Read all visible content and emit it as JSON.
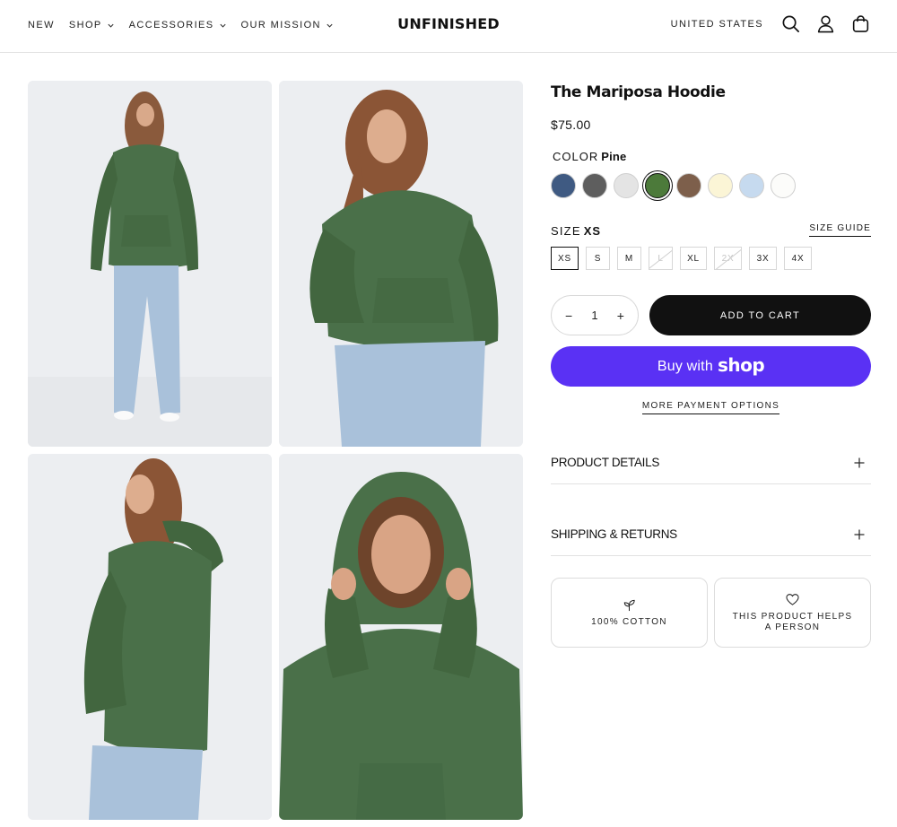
{
  "header": {
    "nav": [
      {
        "label": "NEW",
        "has_dropdown": false
      },
      {
        "label": "SHOP",
        "has_dropdown": true
      },
      {
        "label": "ACCESSORIES",
        "has_dropdown": true
      },
      {
        "label": "OUR MISSION",
        "has_dropdown": true
      }
    ],
    "logo": "UNFINISHED",
    "country": "UNITED STATES",
    "icons": [
      "search-icon",
      "account-icon",
      "cart-bag-icon"
    ]
  },
  "gallery": {
    "hoodie_color": "#4a7049",
    "jeans_color": "#a9c1da",
    "photos": [
      "front-full-length",
      "front-three-quarter",
      "back-side",
      "hood-up-closeup"
    ]
  },
  "product": {
    "title": "The Mariposa Hoodie",
    "price": "$75.00",
    "color_label": "COLOR",
    "color_selected": "Pine",
    "swatches": [
      {
        "name": "Navy",
        "hex": "#3f5a82",
        "selected": false
      },
      {
        "name": "Charcoal",
        "hex": "#5e5e5e",
        "selected": false
      },
      {
        "name": "Heather",
        "hex": "#e4e4e4",
        "selected": false
      },
      {
        "name": "Pine",
        "hex": "#4c7a3a",
        "selected": true
      },
      {
        "name": "Mocha",
        "hex": "#7d5f4b",
        "selected": false
      },
      {
        "name": "Cream",
        "hex": "#fbf5d6",
        "selected": false
      },
      {
        "name": "Sky",
        "hex": "#c6daef",
        "selected": false
      },
      {
        "name": "White",
        "hex": "#fcfcfa",
        "selected": false
      }
    ],
    "size_label": "SIZE",
    "size_selected": "XS",
    "size_guide": "SIZE GUIDE",
    "sizes": [
      {
        "label": "XS",
        "available": true,
        "selected": true
      },
      {
        "label": "S",
        "available": true,
        "selected": false
      },
      {
        "label": "M",
        "available": true,
        "selected": false
      },
      {
        "label": "L",
        "available": false,
        "selected": false
      },
      {
        "label": "XL",
        "available": true,
        "selected": false
      },
      {
        "label": "2X",
        "available": false,
        "selected": false
      },
      {
        "label": "3X",
        "available": true,
        "selected": false
      },
      {
        "label": "4X",
        "available": true,
        "selected": false
      }
    ],
    "quantity": "1",
    "qty_minus": "−",
    "qty_plus": "+",
    "add_to_cart": "ADD TO CART",
    "buy_with": "Buy with",
    "shop_brand": "shop",
    "more_payment": "MORE PAYMENT OPTIONS",
    "accordions": [
      {
        "label": "PRODUCT DETAILS"
      },
      {
        "label": "SHIPPING & RETURNS"
      }
    ],
    "features": [
      {
        "icon": "sprout-icon",
        "text": "100% COTTON"
      },
      {
        "icon": "heart-icon",
        "text": "THIS PRODUCT HELPS A PERSON"
      }
    ]
  }
}
